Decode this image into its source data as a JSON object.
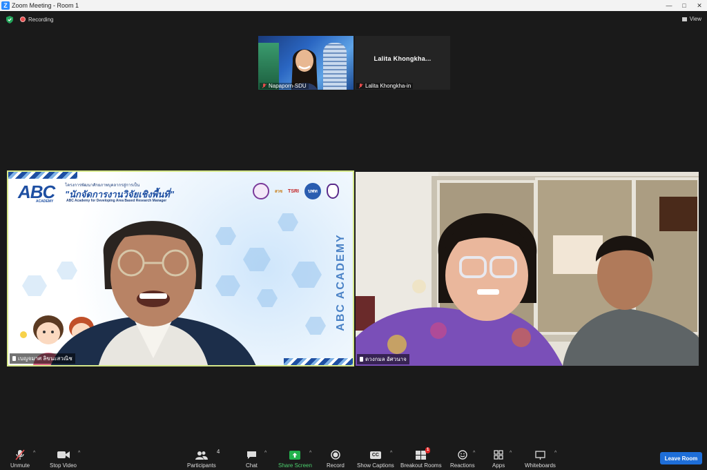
{
  "window": {
    "title": "Zoom Meeting - Room 1",
    "minimize": "—",
    "maximize": "□",
    "close": "✕"
  },
  "topbar": {
    "recording_label": "Recording",
    "view_label": "View"
  },
  "thumbnails": [
    {
      "name": "Napaporn-SDU",
      "muted": true
    },
    {
      "name": "Lalita Khongkha-in",
      "display_name": "Lalita  Khongkha...",
      "muted": true
    }
  ],
  "main_tiles": [
    {
      "name": "เบญจมาศ ลิขนะสวณิช",
      "active_speaker": true,
      "background": {
        "logo_text": "ABC",
        "logo_sub": "ACADEMY",
        "line1": "โครงการพัฒนาศักยภาพบุคลากรสู่การเป็น",
        "line2": "\"นักจัดการงานวิจัยเชิงพื้นที่\"",
        "line3": "ABC Academy for Developing Area Based Research Manager",
        "vertical_text": "ABC ACADEMY",
        "partner_logos": [
          "สวช",
          "TSRI",
          "บพท"
        ]
      }
    },
    {
      "name": "ดวงกมล อัศวนาจ",
      "active_speaker": false
    }
  ],
  "toolbar": {
    "items": [
      {
        "key": "unmute",
        "label": "Unmute"
      },
      {
        "key": "stop_video",
        "label": "Stop Video"
      },
      {
        "key": "participants",
        "label": "Participants",
        "count": "4"
      },
      {
        "key": "chat",
        "label": "Chat"
      },
      {
        "key": "share_screen",
        "label": "Share Screen"
      },
      {
        "key": "record",
        "label": "Record"
      },
      {
        "key": "show_captions",
        "label": "Show Captions",
        "icon_text": "CC"
      },
      {
        "key": "breakout_rooms",
        "label": "Breakout Rooms",
        "badge": "1"
      },
      {
        "key": "reactions",
        "label": "Reactions"
      },
      {
        "key": "apps",
        "label": "Apps"
      },
      {
        "key": "whiteboards",
        "label": "Whiteboards"
      }
    ],
    "caret": "^",
    "leave_label": "Leave Room"
  },
  "colors": {
    "accent": "#2d8cff",
    "share_green": "#22b14c",
    "leave_blue": "#1e6ed8",
    "active_border": "#d6e88a",
    "mute_red": "#e74c4c"
  }
}
